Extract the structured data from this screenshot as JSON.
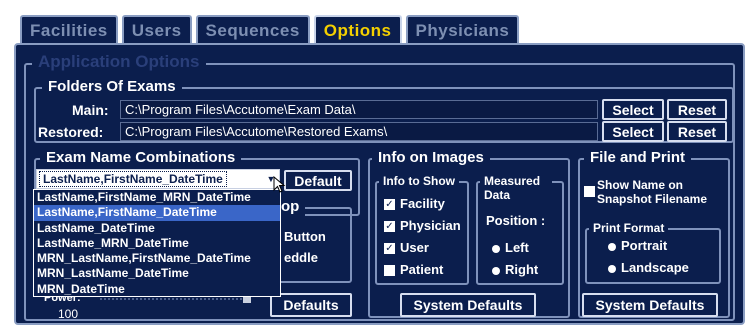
{
  "tabs": [
    {
      "label": "Facilities",
      "active": false
    },
    {
      "label": "Users",
      "active": false
    },
    {
      "label": "Sequences",
      "active": false
    },
    {
      "label": "Options",
      "active": true
    },
    {
      "label": "Physicians",
      "active": false
    }
  ],
  "app_options_title": "Application Options",
  "folders": {
    "title": "Folders Of Exams",
    "main_label": "Main:",
    "main_path": "C:\\Program Files\\Accutome\\Exam Data\\",
    "restored_label": "Restored:",
    "restored_path": "C:\\Program Files\\Accutome\\Restored Exams\\",
    "select_label": "Select",
    "reset_label": "Reset"
  },
  "exam_name": {
    "title": "Exam Name Combinations",
    "selected": "LastName,FirstName_DateTime",
    "default_label": "Default",
    "options": [
      "LastName,FirstName_MRN_DateTime",
      "LastName,FirstName_DateTime",
      "LastName_DateTime",
      "LastName_MRN_DateTime",
      "MRN_LastName,FirstName_DateTime",
      "MRN_LastName_DateTime",
      "MRN_DateTime"
    ],
    "highlighted_index": 1
  },
  "hidden_group": {
    "title_fragment": "top",
    "line1": "Button",
    "line2": "eddle",
    "power_label": "Power:",
    "power_value": "100",
    "defaults_label": "Defaults"
  },
  "info_images": {
    "title": "Info on Images",
    "info_to_show_title": "Info to Show",
    "checks": [
      {
        "label": "Facility",
        "checked": true
      },
      {
        "label": "Physician",
        "checked": true
      },
      {
        "label": "User",
        "checked": true
      },
      {
        "label": "Patient",
        "checked": false
      }
    ],
    "measured_title": "Measured Data",
    "position_label": "Position :",
    "positions": [
      {
        "label": "Left",
        "selected": true
      },
      {
        "label": "Right",
        "selected": false
      }
    ],
    "system_defaults_label": "System Defaults"
  },
  "file_print": {
    "title": "File and Print",
    "show_name_label": "Show Name on Snapshot Filename",
    "show_name_checked": false,
    "print_format_title": "Print Format",
    "formats": [
      {
        "label": "Portrait",
        "selected": false
      },
      {
        "label": "Landscape",
        "selected": true
      }
    ],
    "system_defaults_label": "System Defaults"
  },
  "colors": {
    "background": "#0b1e4d",
    "active_tab_text": "#f4d000",
    "inactive_tab_text": "#7d8fb2",
    "highlight": "#3a66c8"
  }
}
